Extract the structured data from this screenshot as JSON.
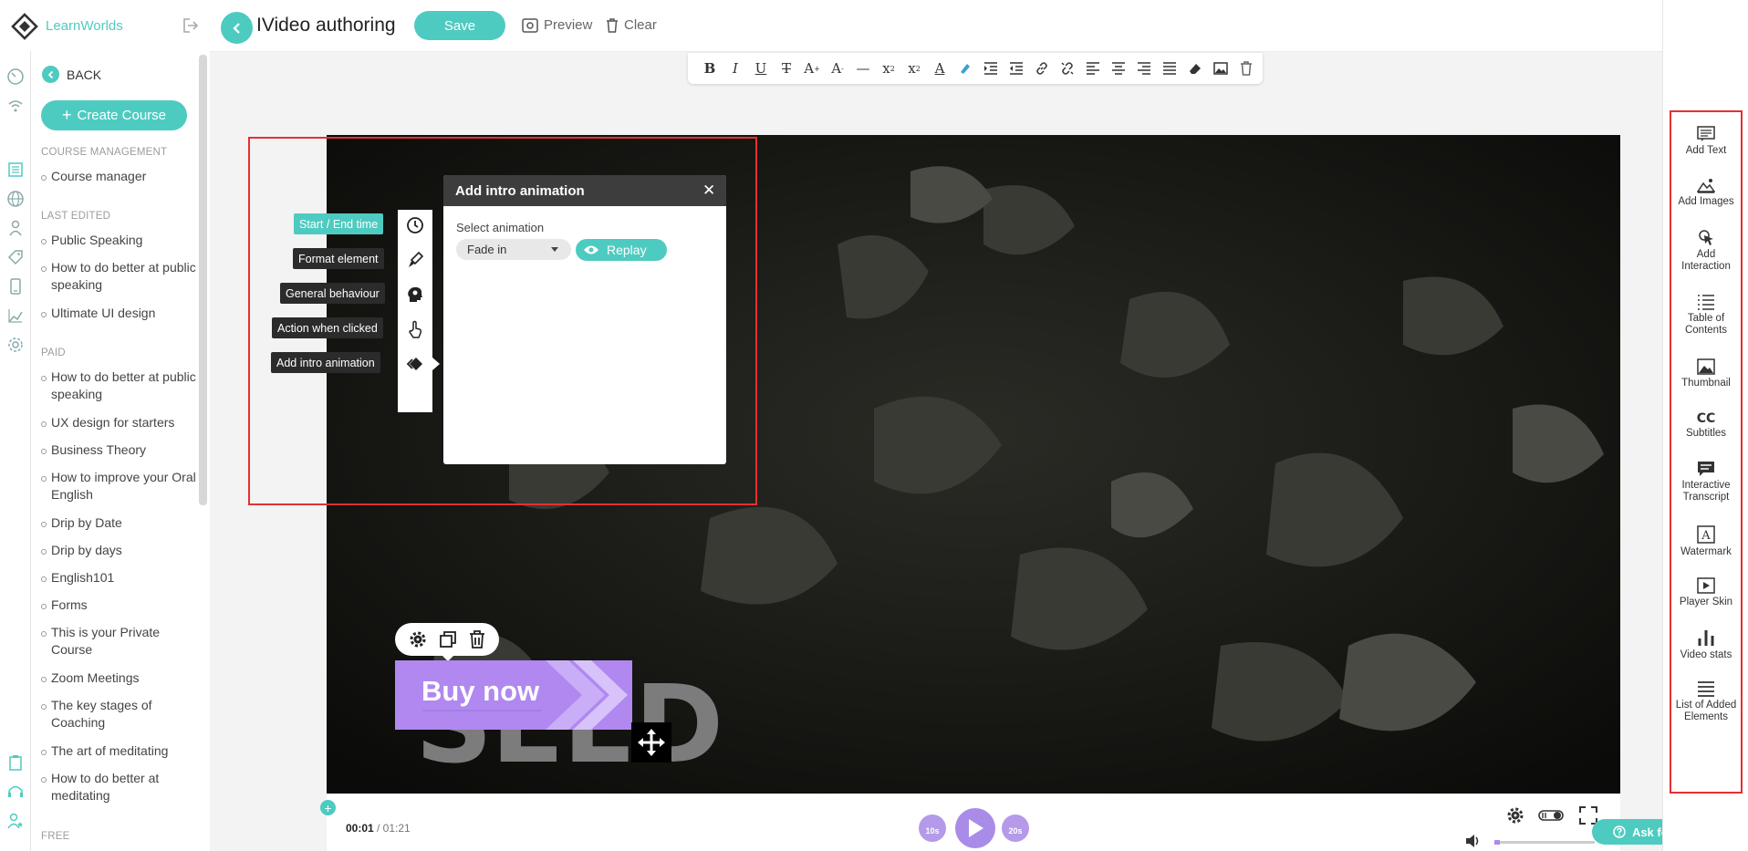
{
  "brand": {
    "name": "LearnWorlds",
    "accent": "#4ecbc0",
    "purple": "#b088f0"
  },
  "sidebar": {
    "back_label": "BACK",
    "create_course_label": "Create Course",
    "sections": [
      {
        "heading": "COURSE MANAGEMENT",
        "items": [
          "Course manager"
        ]
      },
      {
        "heading": "LAST EDITED",
        "items": [
          "Public Speaking",
          "How to do better at public speaking",
          "Ultimate UI design"
        ]
      },
      {
        "heading": "PAID",
        "items": [
          "How to do better at public speaking",
          "UX design for starters",
          "Business Theory",
          "How to improve your Oral English",
          "Drip by Date",
          "Drip by days",
          "English101",
          "Forms",
          "This is your Private Course",
          "Zoom Meetings",
          "The key stages of Coaching",
          "The art of meditating",
          "How to do better at meditating"
        ]
      },
      {
        "heading": "FREE",
        "items": []
      }
    ]
  },
  "header": {
    "title": "IVideo authoring",
    "save_label": "Save",
    "preview_label": "Preview",
    "clear_label": "Clear"
  },
  "format_toolbar": {
    "buttons": [
      "bold",
      "italic",
      "underline",
      "strikethrough",
      "font-size-up",
      "font-size-down",
      "horizontal-line",
      "subscript",
      "superscript",
      "font-color",
      "highlight",
      "indent",
      "outdent",
      "link",
      "unlink",
      "align-left",
      "align-center",
      "align-right",
      "justify",
      "eraser",
      "image",
      "delete"
    ]
  },
  "element_tabs": {
    "start_end_time": "Start / End time",
    "format_element": "Format element",
    "general_behaviour": "General behaviour",
    "action_when_clicked": "Action when clicked",
    "add_intro_animation": "Add intro animation"
  },
  "animation_panel": {
    "title": "Add intro animation",
    "select_label": "Select animation",
    "selected_value": "Fade in",
    "replay_label": "Replay"
  },
  "video": {
    "overlay_text": "SEED",
    "button_label": "Buy now"
  },
  "player": {
    "current_time": "00:01",
    "total_time": "/ 01:21",
    "rewind_label": "10s",
    "forward_label": "20s",
    "volume": 0.05,
    "help_label": "Ask for help"
  },
  "right_panel": {
    "items": [
      {
        "label": "Add Text",
        "icon": "text-icon"
      },
      {
        "label": "Add Images",
        "icon": "image-icon"
      },
      {
        "label": "Add Interaction",
        "icon": "interaction-icon"
      },
      {
        "label": "Table of Contents",
        "icon": "list-icon"
      },
      {
        "label": "Thumbnail",
        "icon": "thumbnail-icon"
      },
      {
        "label": "Subtitles",
        "icon": "cc-icon"
      },
      {
        "label": "Interactive Transcript",
        "icon": "transcript-icon"
      },
      {
        "label": "Watermark",
        "icon": "watermark-icon"
      },
      {
        "label": "Player Skin",
        "icon": "player-icon"
      },
      {
        "label": "Video stats",
        "icon": "stats-icon"
      },
      {
        "label": "List of Added Elements",
        "icon": "menu-icon"
      }
    ]
  }
}
